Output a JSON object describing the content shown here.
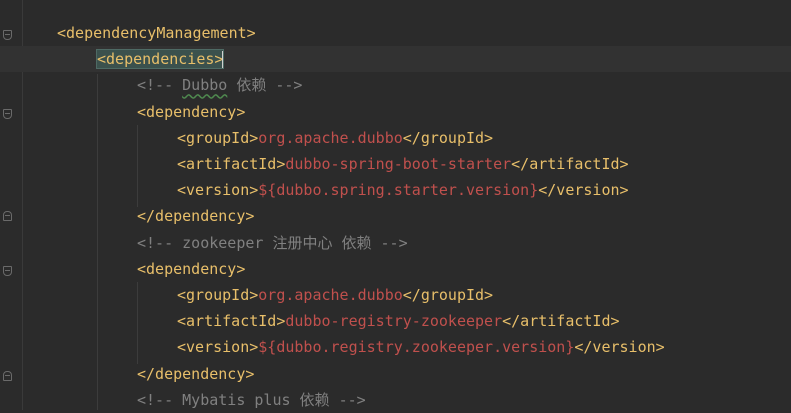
{
  "editor": {
    "lines": [
      {
        "indent": 0,
        "parts": [
          {
            "cls": "t",
            "text": "<dependencyManagement>"
          }
        ]
      },
      {
        "indent": 1,
        "current": true,
        "parts": [
          {
            "cls": "t hl",
            "text": "<dependencies>"
          }
        ]
      },
      {
        "indent": 2,
        "parts": [
          {
            "cls": "c",
            "text": "<!-- "
          },
          {
            "cls": "c spell",
            "text": "Dubbo"
          },
          {
            "cls": "c",
            "text": " 依赖 -->"
          }
        ]
      },
      {
        "indent": 2,
        "parts": [
          {
            "cls": "t",
            "text": "<dependency>"
          }
        ]
      },
      {
        "indent": 3,
        "parts": [
          {
            "cls": "t",
            "text": "<groupId>"
          },
          {
            "cls": "val",
            "text": "org.apache.dubbo"
          },
          {
            "cls": "t",
            "text": "</groupId>"
          }
        ]
      },
      {
        "indent": 3,
        "parts": [
          {
            "cls": "t",
            "text": "<artifactId>"
          },
          {
            "cls": "val",
            "text": "dubbo-spring-boot-starter"
          },
          {
            "cls": "t",
            "text": "</artifactId>"
          }
        ]
      },
      {
        "indent": 3,
        "parts": [
          {
            "cls": "t",
            "text": "<version>"
          },
          {
            "cls": "val",
            "text": "${dubbo.spring.starter.version}"
          },
          {
            "cls": "t",
            "text": "</version>"
          }
        ]
      },
      {
        "indent": 2,
        "parts": [
          {
            "cls": "t",
            "text": "</dependency>"
          }
        ]
      },
      {
        "indent": 2,
        "parts": [
          {
            "cls": "c",
            "text": "<!-- zookeeper 注册中心 依赖 -->"
          }
        ]
      },
      {
        "indent": 2,
        "parts": [
          {
            "cls": "t",
            "text": "<dependency>"
          }
        ]
      },
      {
        "indent": 3,
        "parts": [
          {
            "cls": "t",
            "text": "<groupId>"
          },
          {
            "cls": "val",
            "text": "org.apache.dubbo"
          },
          {
            "cls": "t",
            "text": "</groupId>"
          }
        ]
      },
      {
        "indent": 3,
        "parts": [
          {
            "cls": "t",
            "text": "<artifactId>"
          },
          {
            "cls": "val",
            "text": "dubbo-registry-zookeeper"
          },
          {
            "cls": "t",
            "text": "</artifactId>"
          }
        ]
      },
      {
        "indent": 3,
        "parts": [
          {
            "cls": "t",
            "text": "<version>"
          },
          {
            "cls": "val",
            "text": "${dubbo.registry.zookeeper.version}"
          },
          {
            "cls": "t",
            "text": "</version>"
          }
        ]
      },
      {
        "indent": 2,
        "parts": [
          {
            "cls": "t",
            "text": "</dependency>"
          }
        ]
      },
      {
        "indent": 2,
        "parts": [
          {
            "cls": "c",
            "text": "<!-- Mybatis plus 依赖 -->"
          }
        ]
      }
    ]
  }
}
